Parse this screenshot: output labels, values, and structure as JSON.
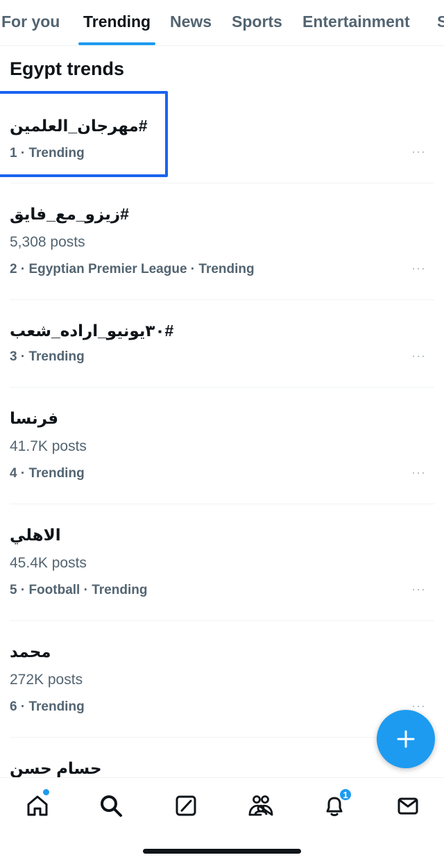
{
  "tabs": [
    {
      "label": "For you"
    },
    {
      "label": "Trending"
    },
    {
      "label": "News"
    },
    {
      "label": "Sports"
    },
    {
      "label": "Entertainment"
    },
    {
      "label": "S"
    }
  ],
  "active_tab": "Trending",
  "section_title": "Egypt trends",
  "trends": [
    {
      "name": "#مهرجان_العلمين",
      "posts": "",
      "meta": "1 · Trending"
    },
    {
      "name": "#زيزو_مع_فايق",
      "posts": "5,308 posts",
      "meta": "2 · Egyptian Premier League · Trending"
    },
    {
      "name": "#٣٠يونيو_اراده_شعب",
      "posts": "",
      "meta": "3 · Trending"
    },
    {
      "name": "فرنسا",
      "posts": "41.7K posts",
      "meta": "4 · Trending"
    },
    {
      "name": "الاهلي",
      "posts": "45.4K posts",
      "meta": "5 · Football · Trending"
    },
    {
      "name": "محمد",
      "posts": "272K posts",
      "meta": "6 · Trending"
    },
    {
      "name": "حسام حسن",
      "posts": "",
      "meta": ""
    }
  ],
  "more_label": "···",
  "fab_icon": "plus-icon",
  "bottom_nav": [
    {
      "icon": "home-icon"
    },
    {
      "icon": "search-icon"
    },
    {
      "icon": "grok-icon"
    },
    {
      "icon": "communities-icon"
    },
    {
      "icon": "notifications-icon",
      "badge": "1"
    },
    {
      "icon": "messages-icon"
    }
  ],
  "colors": {
    "accent": "#1d9bf0",
    "text": "#0f1419",
    "secondary": "#536471",
    "highlight_box": "#1a64f0"
  }
}
